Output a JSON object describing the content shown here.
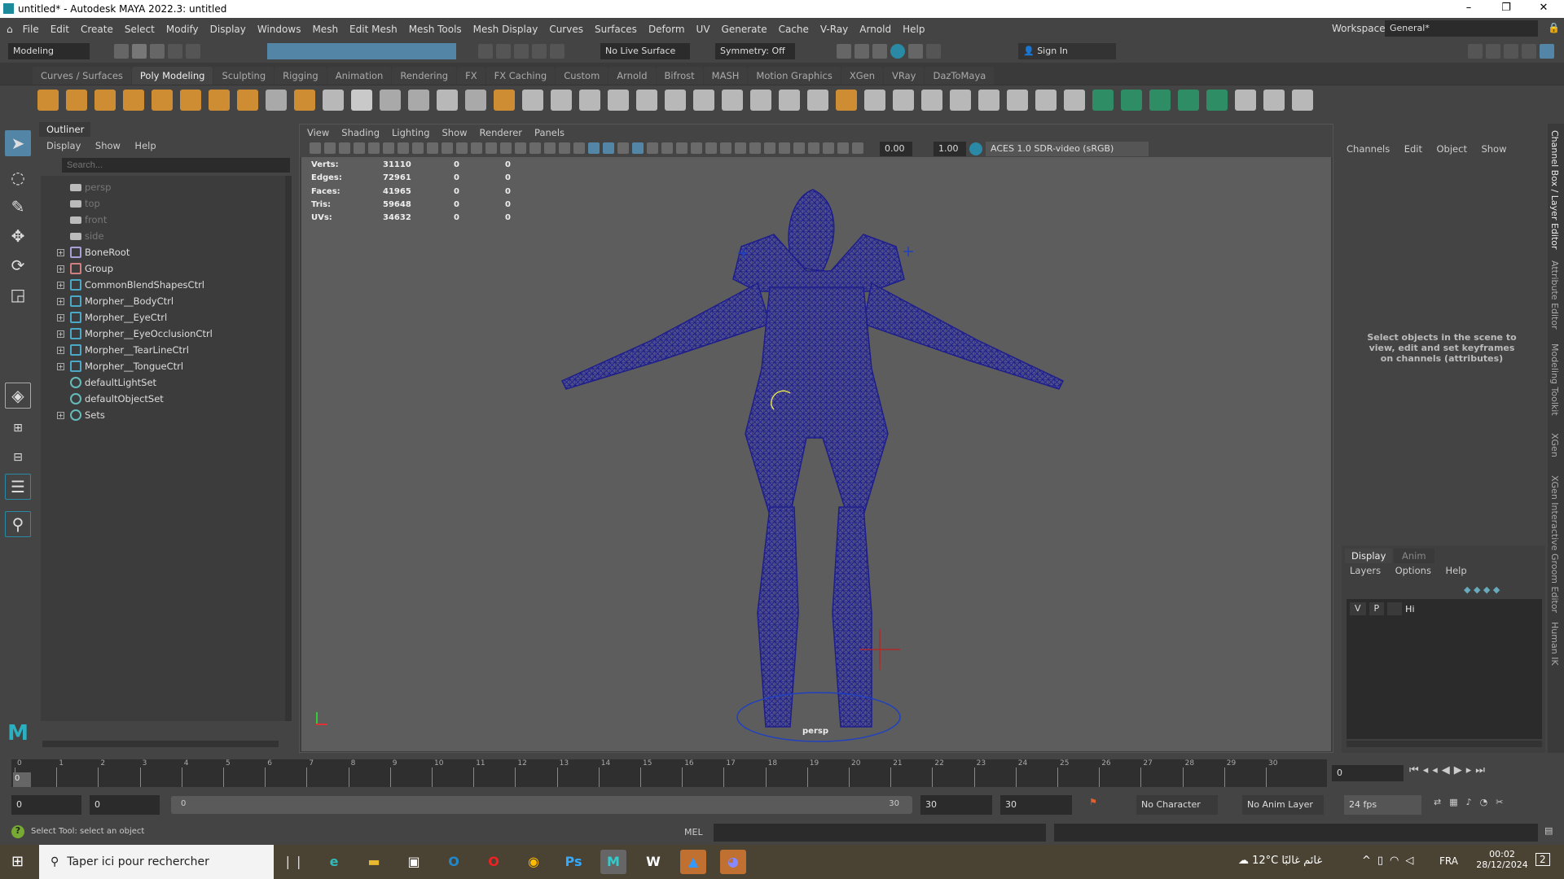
{
  "window": {
    "title": "untitled* - Autodesk MAYA 2022.3: untitled",
    "minimize": "–",
    "restore": "❐",
    "close": "✕"
  },
  "menubar": {
    "items": [
      "File",
      "Edit",
      "Create",
      "Select",
      "Modify",
      "Display",
      "Windows",
      "Mesh",
      "Edit Mesh",
      "Mesh Tools",
      "Mesh Display",
      "Curves",
      "Surfaces",
      "Deform",
      "UV",
      "Generate",
      "Cache",
      "V-Ray",
      "Arnold",
      "Help"
    ],
    "workspace_label": "Workspace:",
    "workspace_value": "General*"
  },
  "statusline": {
    "menuset": "Modeling",
    "live_surface": "No Live Surface",
    "symmetry": "Symmetry: Off",
    "sign_in": "Sign In"
  },
  "shelf": {
    "tabs": [
      "Curves / Surfaces",
      "Poly Modeling",
      "Sculpting",
      "Rigging",
      "Animation",
      "Rendering",
      "FX",
      "FX Caching",
      "Custom",
      "Arnold",
      "Bifrost",
      "MASH",
      "Motion Graphics",
      "XGen",
      "VRay",
      "DazToMaya"
    ],
    "active": "Poly Modeling"
  },
  "outliner": {
    "title": "Outliner",
    "menus": [
      "Display",
      "Show",
      "Help"
    ],
    "search_placeholder": "Search...",
    "items": [
      {
        "label": "persp",
        "type": "camera",
        "expand": false,
        "dim": true
      },
      {
        "label": "top",
        "type": "camera",
        "expand": false,
        "dim": true
      },
      {
        "label": "front",
        "type": "camera",
        "expand": false,
        "dim": true
      },
      {
        "label": "side",
        "type": "camera",
        "expand": false,
        "dim": true
      },
      {
        "label": "BoneRoot",
        "type": "joint",
        "expand": true
      },
      {
        "label": "Group",
        "type": "group",
        "expand": true
      },
      {
        "label": "CommonBlendShapesCtrl",
        "type": "curve",
        "expand": true
      },
      {
        "label": "Morpher__BodyCtrl",
        "type": "curve",
        "expand": true
      },
      {
        "label": "Morpher__EyeCtrl",
        "type": "curve",
        "expand": true
      },
      {
        "label": "Morpher__EyeOcclusionCtrl",
        "type": "curve",
        "expand": true
      },
      {
        "label": "Morpher__TearLineCtrl",
        "type": "curve",
        "expand": true
      },
      {
        "label": "Morpher__TongueCtrl",
        "type": "curve",
        "expand": true
      },
      {
        "label": "defaultLightSet",
        "type": "set",
        "expand": false
      },
      {
        "label": "defaultObjectSet",
        "type": "set",
        "expand": false
      },
      {
        "label": "Sets",
        "type": "set",
        "expand": true
      }
    ]
  },
  "viewport": {
    "menus": [
      "View",
      "Shading",
      "Lighting",
      "Show",
      "Renderer",
      "Panels"
    ],
    "exposure": "0.00",
    "gamma": "1.00",
    "color_space": "ACES 1.0 SDR-video (sRGB)",
    "camera_label": "persp",
    "stats": [
      {
        "label": "Verts:",
        "values": [
          "31110",
          "0",
          "0"
        ]
      },
      {
        "label": "Edges:",
        "values": [
          "72961",
          "0",
          "0"
        ]
      },
      {
        "label": "Faces:",
        "values": [
          "41965",
          "0",
          "0"
        ]
      },
      {
        "label": "Tris:",
        "values": [
          "59648",
          "0",
          "0"
        ]
      },
      {
        "label": "UVs:",
        "values": [
          "34632",
          "0",
          "0"
        ]
      }
    ]
  },
  "channelbox": {
    "menus": [
      "Channels",
      "Edit",
      "Object",
      "Show"
    ],
    "hint": "Select objects in the scene to view, edit and set keyframes on channels (attributes)"
  },
  "layereditor": {
    "tabs": [
      "Display",
      "Anim"
    ],
    "menus": [
      "Layers",
      "Options",
      "Help"
    ],
    "layer": {
      "v": "V",
      "p": "P",
      "name": "Hi"
    }
  },
  "side_tabs": [
    "Channel Box / Layer Editor",
    "Attribute Editor",
    "Modeling Toolkit",
    "XGen",
    "XGen Interactive Groom Editor",
    "Human IK"
  ],
  "timeline": {
    "ticks": [
      "0",
      "1",
      "2",
      "3",
      "4",
      "5",
      "6",
      "7",
      "8",
      "9",
      "10",
      "11",
      "12",
      "13",
      "14",
      "15",
      "16",
      "17",
      "18",
      "19",
      "20",
      "21",
      "22",
      "23",
      "24",
      "25",
      "26",
      "27",
      "28",
      "29",
      "30"
    ],
    "current": "0",
    "current_frame_field": "0"
  },
  "range": {
    "start": "0",
    "anim_start": "0",
    "slider_start": "0",
    "slider_end": "30",
    "anim_end": "30",
    "end": "30",
    "character_set": "No Character Set",
    "anim_layer": "No Anim Layer",
    "fps": "24 fps"
  },
  "commandline": {
    "help": "Select Tool: select an object",
    "lang": "MEL"
  },
  "taskbar": {
    "search_placeholder": "Taper ici pour rechercher",
    "weather": "12°C  غائم غالبًا",
    "lang": "FRA",
    "time": "00:02",
    "date": "28/12/2024",
    "notif": "2"
  },
  "colors": {
    "accent": "#5285a6",
    "wire": "#1e1e8c",
    "bg": "#444444"
  }
}
